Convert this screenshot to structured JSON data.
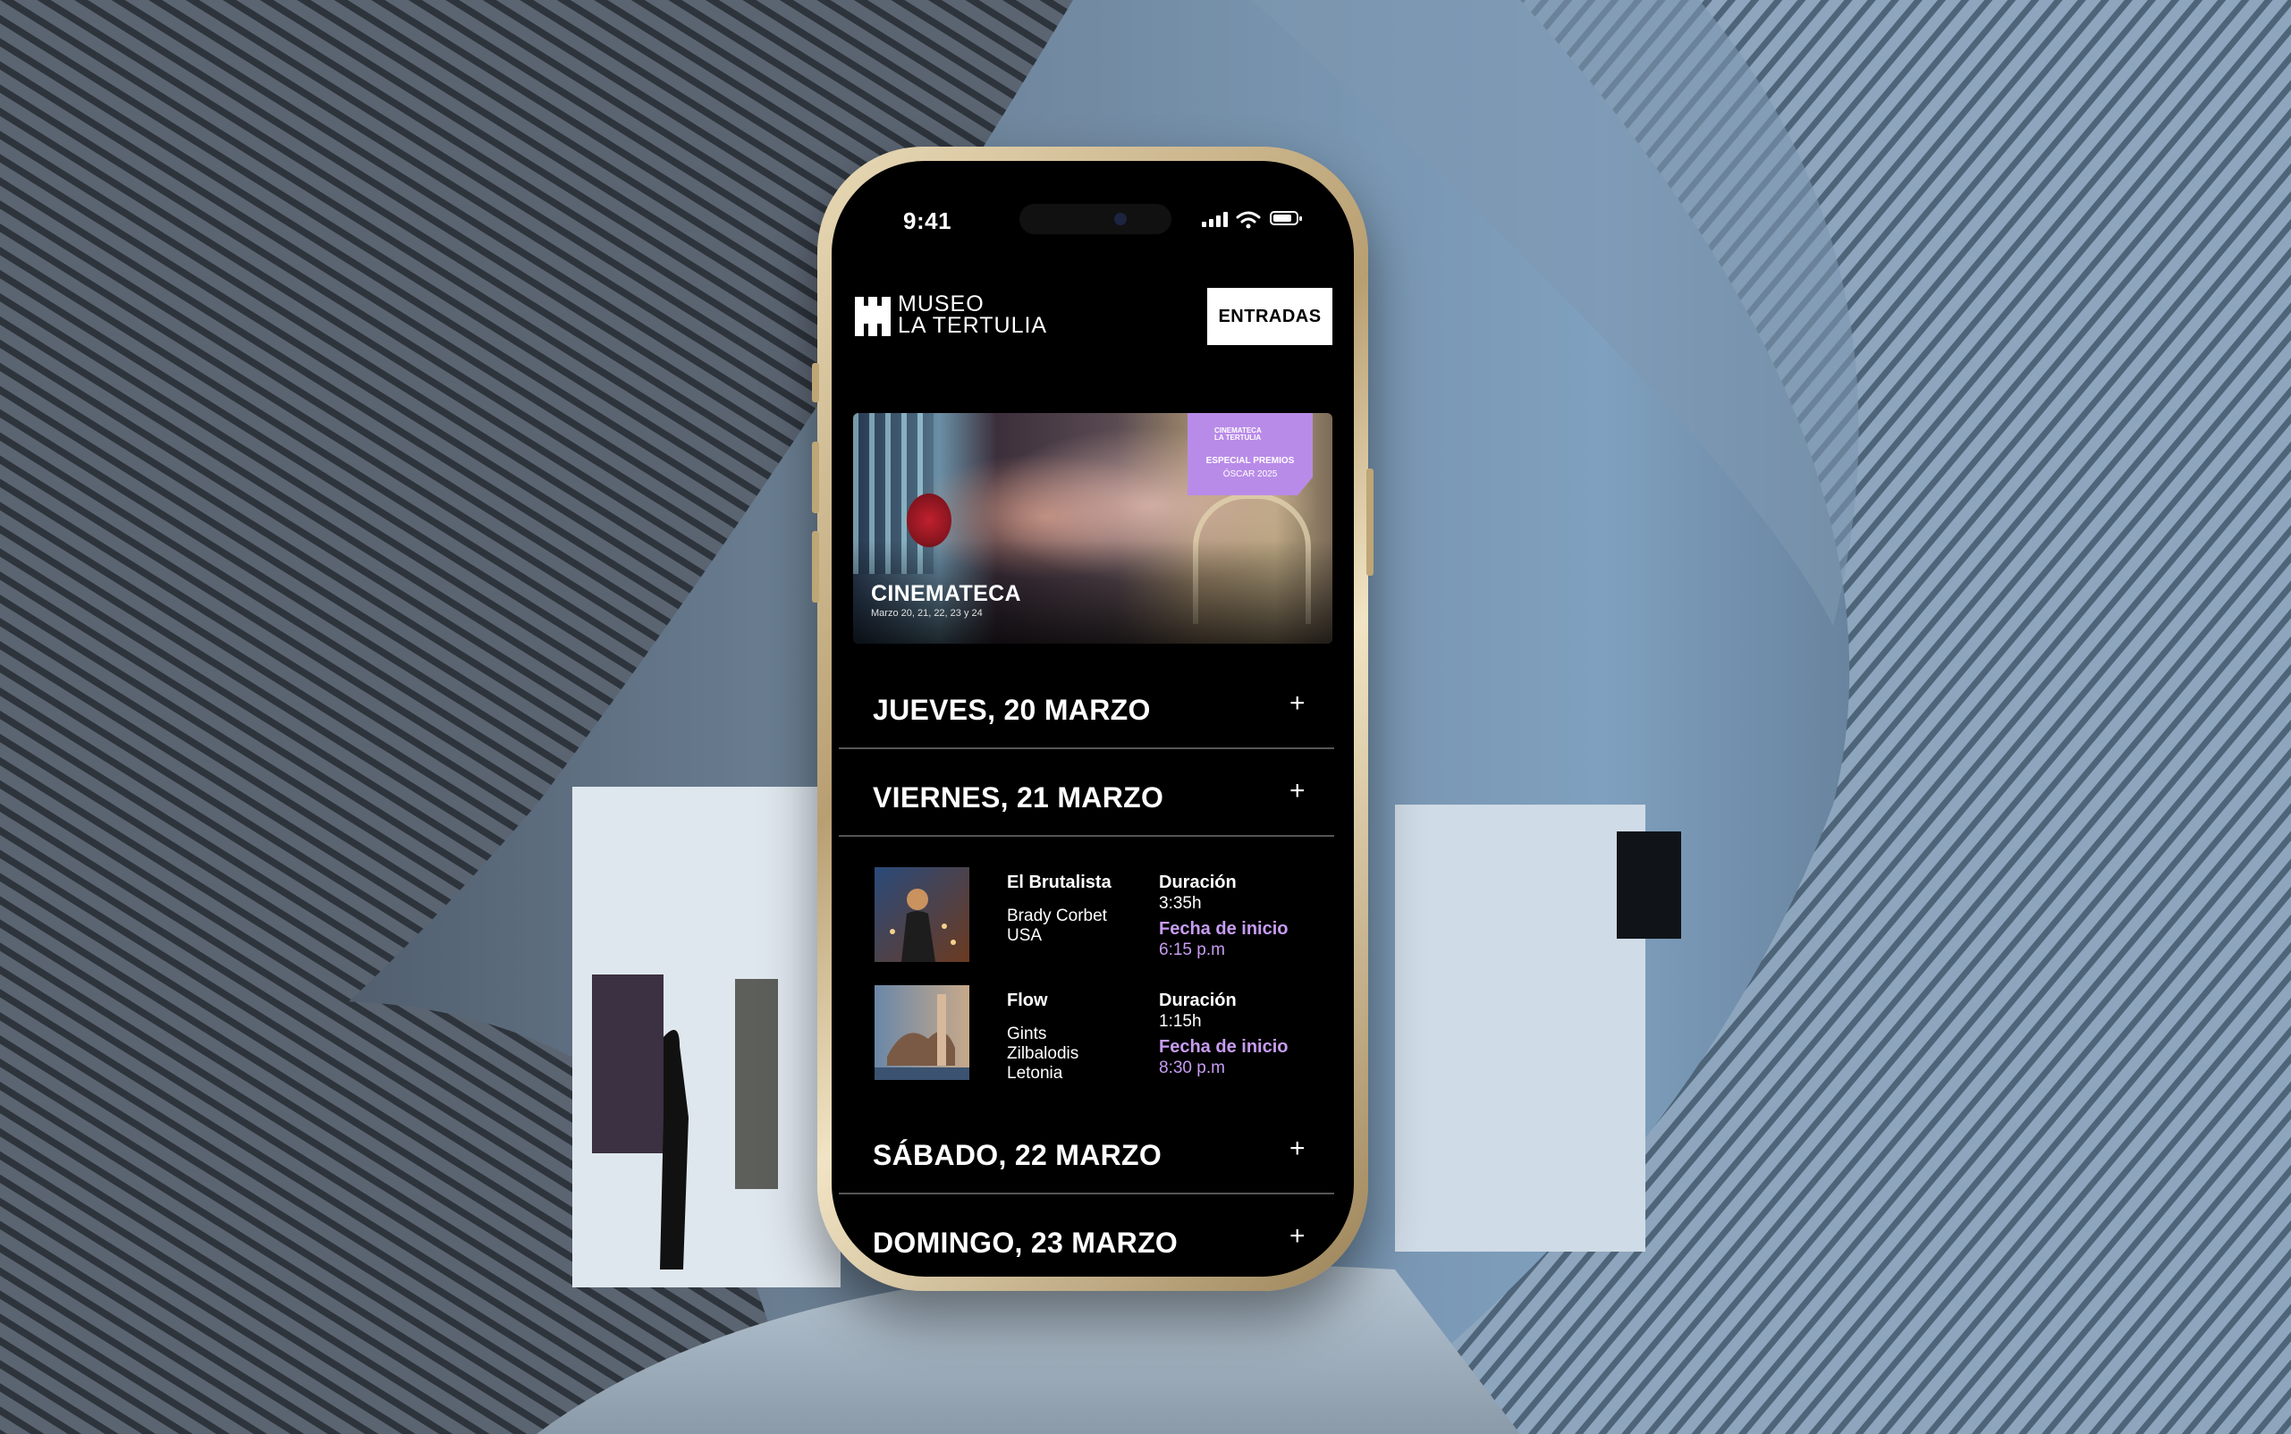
{
  "status_bar": {
    "time": "9:41"
  },
  "header": {
    "logo_line1": "MUSEO",
    "logo_line2": "LA TERTULIA",
    "cta_label": "ENTRADAS"
  },
  "hero": {
    "badge_logo_line1": "CINEMATECA",
    "badge_logo_line2": "LA TERTULIA",
    "badge_line1": "ESPECIAL PREMIOS",
    "badge_line2": "ÓSCAR 2025",
    "title": "CINEMATECA",
    "subtitle": "Marzo 20, 21, 22, 23 y 24"
  },
  "days": [
    {
      "label": "JUEVES, 20 MARZO",
      "toggle": "+"
    },
    {
      "label": "VIERNES, 21 MARZO",
      "toggle": "+"
    },
    {
      "label": "SÁBADO, 22 MARZO",
      "toggle": "+"
    },
    {
      "label": "DOMINGO, 23 MARZO",
      "toggle": "+"
    }
  ],
  "films": [
    {
      "title": "El Brutalista",
      "director": "Brady Corbet",
      "country": "USA",
      "duration_label": "Duración",
      "duration": "3:35h",
      "start_label": "Fecha de inicio",
      "start": "6:15 p.m"
    },
    {
      "title": "Flow",
      "director_line1": "Gints",
      "director_line2": "Zilbalodis",
      "country": "Letonia",
      "duration_label": "Duración",
      "duration": "1:15h",
      "start_label": "Fecha de inicio",
      "start": "8:30 p.m"
    }
  ],
  "colors": {
    "accent": "#c79cf2",
    "badge": "#b98be8",
    "screen": "#000000"
  }
}
